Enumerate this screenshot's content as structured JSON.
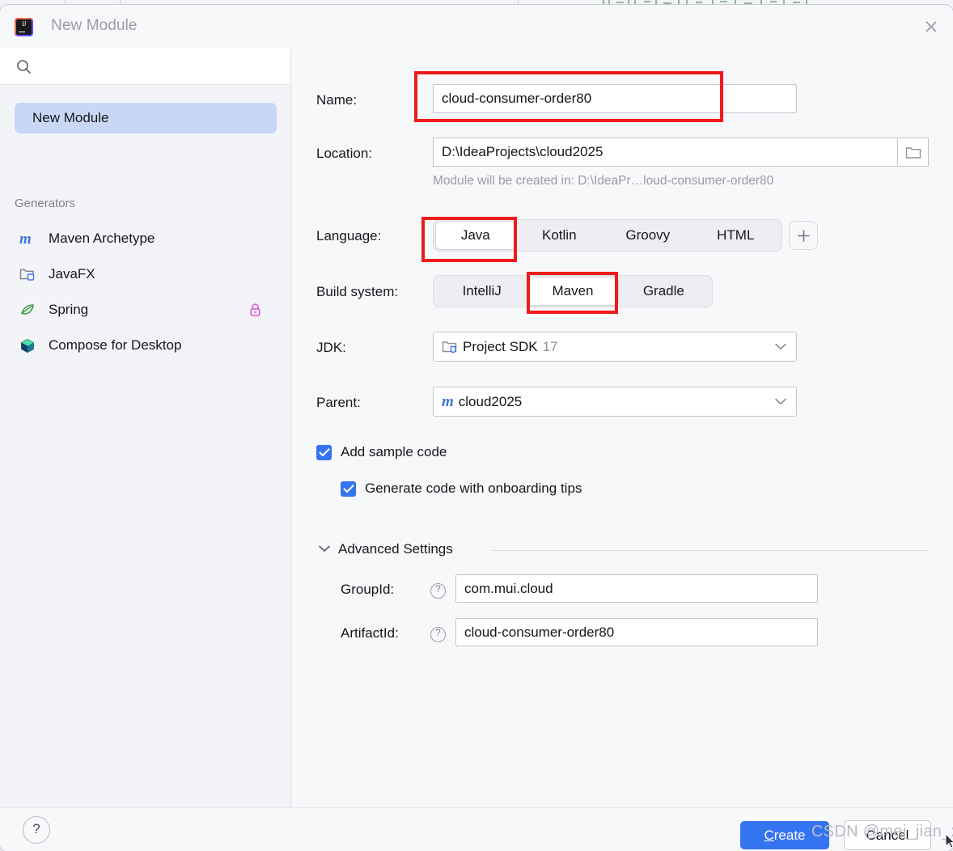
{
  "window": {
    "title": "New Module",
    "app_icon": "intellij-idea-logo",
    "close_icon": "close-icon"
  },
  "sidebar": {
    "search": {
      "value": "",
      "placeholder": "",
      "icon": "search-icon"
    },
    "selected_item": "New Module",
    "generators_label": "Generators",
    "generators": [
      {
        "label": "Maven Archetype",
        "icon": "maven-m-icon",
        "locked": false
      },
      {
        "label": "JavaFX",
        "icon": "javafx-folder-icon",
        "locked": false
      },
      {
        "label": "Spring",
        "icon": "spring-leaf-icon",
        "locked": true,
        "lock_icon": "lock-icon"
      },
      {
        "label": "Compose for Desktop",
        "icon": "compose-cube-icon",
        "locked": false
      }
    ]
  },
  "form": {
    "name": {
      "label": "Name:",
      "value": "cloud-consumer-order80",
      "highlighted": true
    },
    "location": {
      "label": "Location:",
      "value": "D:\\IdeaProjects\\cloud2025",
      "browse_icon": "folder-icon",
      "hint": "Module will be created in: D:\\IdeaPr…loud-consumer-order80"
    },
    "language": {
      "label": "Language:",
      "options": [
        "Java",
        "Kotlin",
        "Groovy",
        "HTML"
      ],
      "selected": "Java",
      "add_button_icon": "plus-icon",
      "highlighted": true
    },
    "build_system": {
      "label": "Build system:",
      "options": [
        "IntelliJ",
        "Maven",
        "Gradle"
      ],
      "selected": "Maven",
      "highlighted": true
    },
    "jdk": {
      "label": "JDK:",
      "value": "Project SDK",
      "version": "17",
      "icon": "jdk-folder-icon",
      "chevron": "chevron-down-icon"
    },
    "parent": {
      "label": "Parent:",
      "value": "cloud2025",
      "icon": "maven-m-icon",
      "chevron": "chevron-down-icon"
    },
    "add_sample_code": {
      "label": "Add sample code",
      "checked": true
    },
    "onboarding_tips": {
      "label": "Generate code with onboarding tips",
      "checked": true
    },
    "advanced": {
      "label": "Advanced Settings",
      "expanded": true,
      "chevron": "chevron-down-icon",
      "group_id": {
        "label": "GroupId:",
        "value": "com.mui.cloud",
        "help_icon": "help-icon"
      },
      "artifact_id": {
        "label": "ArtifactId:",
        "value": "cloud-consumer-order80",
        "help_icon": "help-icon"
      }
    }
  },
  "footer": {
    "help_label": "?",
    "create_label_prefix": "C",
    "create_label_rest": "reate",
    "cancel_label": "Cancel"
  },
  "overlay": {
    "watermark": "CSDN @mei_jian_xue"
  },
  "colors": {
    "accent_blue": "#3574f0",
    "selection_blue": "#c9d7f6",
    "annotation_red": "#f01a1a",
    "dialog_bg": "#f7f8fa",
    "sidebar_bg": "#f3f4f7",
    "field_bg": "#ffffff",
    "muted_text": "#9a9ca5"
  }
}
